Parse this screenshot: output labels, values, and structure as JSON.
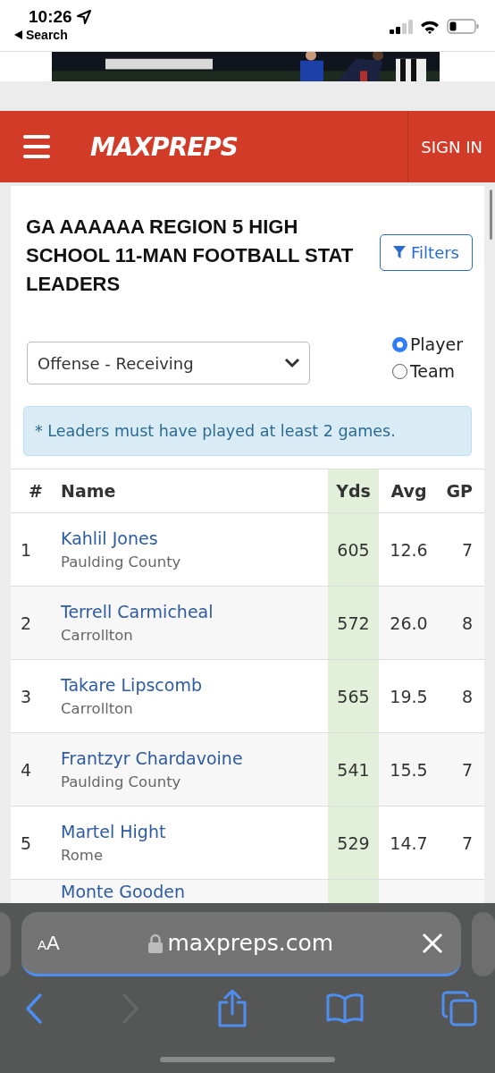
{
  "status_bar": {
    "time": "10:26",
    "back_label": "Search"
  },
  "header": {
    "logo": "MAXPREPS",
    "sign_in": "SIGN IN"
  },
  "page": {
    "title": "GA AAAAAA REGION 5 HIGH SCHOOL 11-MAN FOOTBALL STAT LEADERS",
    "filters_button": "Filters",
    "category_select": "Offense - Receiving",
    "view_options": [
      {
        "label": "Player",
        "selected": true
      },
      {
        "label": "Team",
        "selected": false
      }
    ],
    "notice": "* Leaders must have played at least 2 games."
  },
  "table": {
    "columns": [
      "#",
      "Name",
      "Yds",
      "Avg",
      "GP"
    ],
    "rows": [
      {
        "rank": "1",
        "name": "Kahlil Jones",
        "school": "Paulding County",
        "yds": "605",
        "avg": "12.6",
        "gp": "7"
      },
      {
        "rank": "2",
        "name": "Terrell Carmicheal",
        "school": "Carrollton",
        "yds": "572",
        "avg": "26.0",
        "gp": "8"
      },
      {
        "rank": "3",
        "name": "Takare Lipscomb",
        "school": "Carrollton",
        "yds": "565",
        "avg": "19.5",
        "gp": "8"
      },
      {
        "rank": "4",
        "name": "Frantzyr Chardavoine",
        "school": "Paulding County",
        "yds": "541",
        "avg": "15.5",
        "gp": "7"
      },
      {
        "rank": "5",
        "name": "Martel Hight",
        "school": "Rome",
        "yds": "529",
        "avg": "14.7",
        "gp": "7"
      },
      {
        "name": "Monte Gooden"
      }
    ]
  },
  "browser": {
    "text_size": "AA",
    "url": "maxpreps.com"
  }
}
